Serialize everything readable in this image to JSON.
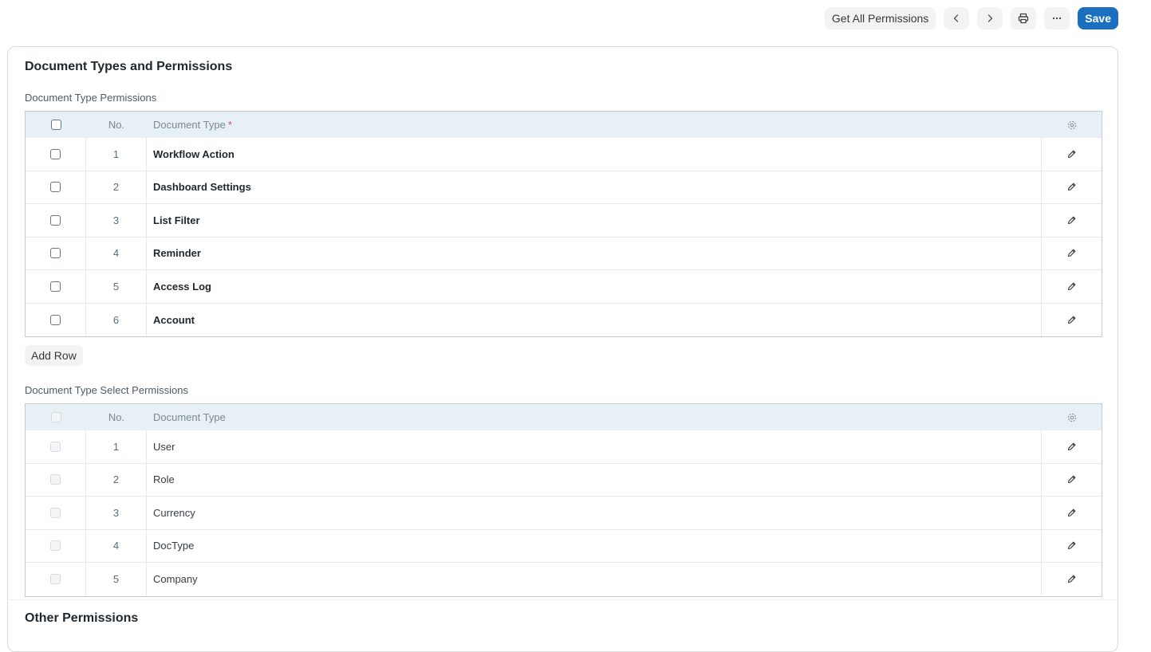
{
  "toolbar": {
    "get_all_label": "Get All Permissions",
    "save_label": "Save"
  },
  "section1": {
    "title": "Document Types and Permissions",
    "perm_label": "Document Type Permissions",
    "select_label": "Document Type Select Permissions",
    "add_row_label": "Add Row"
  },
  "grid1": {
    "headers": {
      "no": "No.",
      "type": "Document Type",
      "required": "*"
    },
    "rows": [
      {
        "no": "1",
        "type": "Workflow Action"
      },
      {
        "no": "2",
        "type": "Dashboard Settings"
      },
      {
        "no": "3",
        "type": "List Filter"
      },
      {
        "no": "4",
        "type": "Reminder"
      },
      {
        "no": "5",
        "type": "Access Log"
      },
      {
        "no": "6",
        "type": "Account"
      }
    ]
  },
  "grid2": {
    "headers": {
      "no": "No.",
      "type": "Document Type"
    },
    "rows": [
      {
        "no": "1",
        "type": "User"
      },
      {
        "no": "2",
        "type": "Role"
      },
      {
        "no": "3",
        "type": "Currency"
      },
      {
        "no": "4",
        "type": "DocType"
      },
      {
        "no": "5",
        "type": "Company"
      }
    ]
  },
  "section2": {
    "title": "Other Permissions"
  },
  "colors": {
    "primary": "#1a6fc0",
    "header_bg": "#e6f0f5",
    "required": "#e24c4c"
  },
  "icons": [
    "chevron-left-icon",
    "chevron-right-icon",
    "printer-icon",
    "more-icon",
    "gear-icon",
    "pencil-icon"
  ]
}
